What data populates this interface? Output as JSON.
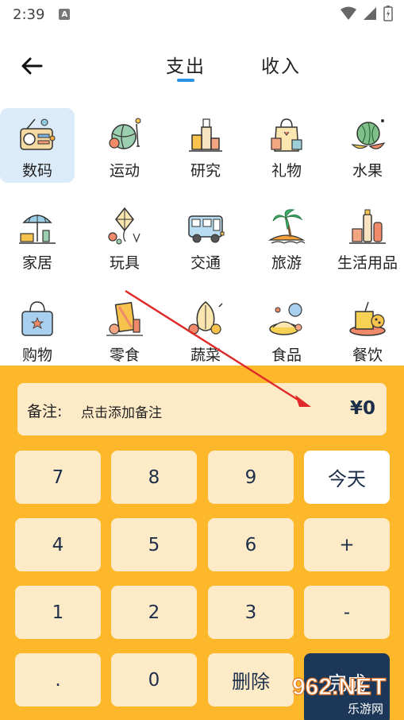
{
  "status": {
    "time": "2:39",
    "notification": "A"
  },
  "header": {
    "tabs": [
      {
        "label": "支出",
        "active": true
      },
      {
        "label": "收入",
        "active": false
      }
    ]
  },
  "categories": [
    {
      "label": "数码",
      "icon": "radio-icon",
      "selected": true
    },
    {
      "label": "运动",
      "icon": "sports-ball-icon",
      "selected": false
    },
    {
      "label": "研究",
      "icon": "lab-bottles-icon",
      "selected": false
    },
    {
      "label": "礼物",
      "icon": "gift-bag-icon",
      "selected": false
    },
    {
      "label": "水果",
      "icon": "watermelon-icon",
      "selected": false
    },
    {
      "label": "家居",
      "icon": "umbrella-chair-icon",
      "selected": false
    },
    {
      "label": "玩具",
      "icon": "kite-icon",
      "selected": false
    },
    {
      "label": "交通",
      "icon": "camper-van-icon",
      "selected": false
    },
    {
      "label": "旅游",
      "icon": "palm-island-icon",
      "selected": false
    },
    {
      "label": "生活用品",
      "icon": "toiletries-icon",
      "selected": false
    },
    {
      "label": "购物",
      "icon": "shopping-bag-icon",
      "selected": false
    },
    {
      "label": "零食",
      "icon": "snack-icon",
      "selected": false
    },
    {
      "label": "蔬菜",
      "icon": "vegetables-icon",
      "selected": false
    },
    {
      "label": "食品",
      "icon": "food-plate-icon",
      "selected": false
    },
    {
      "label": "餐饮",
      "icon": "drink-cake-icon",
      "selected": false
    }
  ],
  "note": {
    "label": "备注:",
    "placeholder": "点击添加备注",
    "amount": "¥0"
  },
  "keypad": {
    "rows": [
      [
        "7",
        "8",
        "9",
        "今天"
      ],
      [
        "4",
        "5",
        "6",
        "+"
      ],
      [
        "1",
        "2",
        "3",
        "-"
      ],
      [
        ".",
        "0",
        "删除",
        "完成"
      ]
    ]
  },
  "watermark": {
    "text": "962.NET",
    "sub": "乐游网"
  },
  "colors": {
    "panel": "#fcb72b",
    "key": "#fdebc8",
    "accent": "#2a92e6",
    "done": "#1d3758",
    "selected": "#dcebf9"
  }
}
